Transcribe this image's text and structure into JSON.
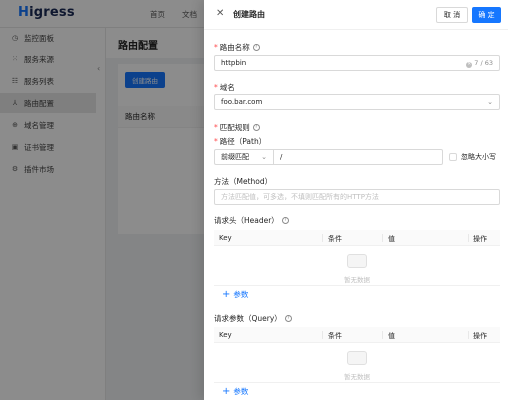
{
  "app": {
    "logo": "Higress",
    "logo_first": "H",
    "logo_rest": "igress",
    "topnav": [
      "首页",
      "文档"
    ]
  },
  "sidebar": {
    "items": [
      {
        "label": "监控面板",
        "icon": "dashboard-icon",
        "active": false
      },
      {
        "label": "服务来源",
        "icon": "service-source-icon",
        "active": false
      },
      {
        "label": "服务列表",
        "icon": "service-list-icon",
        "active": false
      },
      {
        "label": "路由配置",
        "icon": "route-icon",
        "active": true
      },
      {
        "label": "域名管理",
        "icon": "domain-icon",
        "active": false
      },
      {
        "label": "证书管理",
        "icon": "certificate-icon",
        "active": false
      },
      {
        "label": "插件市场",
        "icon": "plugin-icon",
        "active": false
      }
    ]
  },
  "main": {
    "title": "路由配置",
    "create_button": "创建路由",
    "table_header": "路由名称"
  },
  "drawer": {
    "title": "创建路由",
    "cancel": "取 消",
    "ok": "确 定",
    "route_name": {
      "label": "路由名称",
      "value": "httpbin",
      "count": "7 / 63"
    },
    "domain": {
      "label": "域名",
      "value": "foo.bar.com"
    },
    "match_rule": {
      "label": "匹配规则"
    },
    "path": {
      "label": "路径（Path）",
      "match_type": "前缀匹配",
      "value": "/",
      "ignore_case": "忽略大小写"
    },
    "method": {
      "label": "方法（Method）",
      "placeholder": "方法匹配值，可多选，不填则匹配所有的HTTP方法"
    },
    "header": {
      "label": "请求头（Header）",
      "columns": [
        "Key",
        "条件",
        "值",
        "操作"
      ],
      "empty": "暂无数据",
      "add": "参数"
    },
    "query": {
      "label": "请求参数（Query）",
      "columns": [
        "Key",
        "条件",
        "值",
        "操作"
      ],
      "empty": "暂无数据",
      "add": "参数"
    }
  },
  "colors": {
    "primary": "#1677ff",
    "required": "#ff4d4f"
  }
}
